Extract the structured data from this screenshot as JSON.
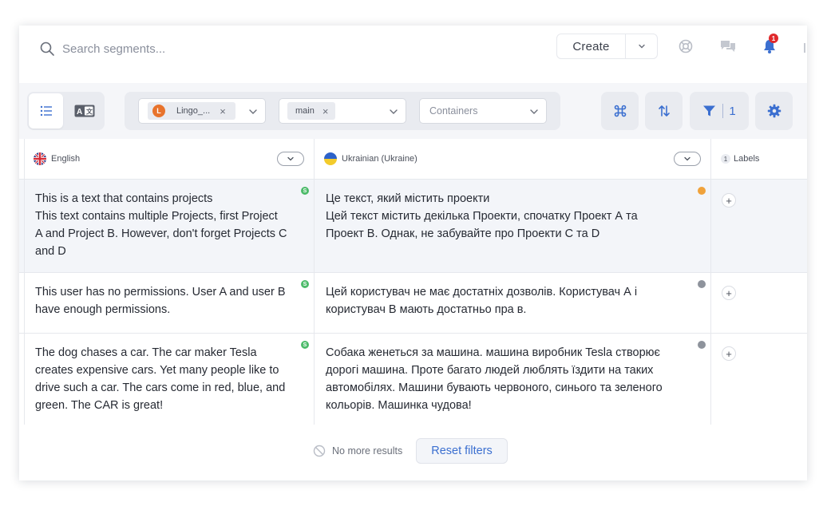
{
  "search": {
    "placeholder": "Search segments..."
  },
  "header": {
    "create_label": "Create",
    "notification_count": "1",
    "icons": [
      "search-icon",
      "chevron-down-icon",
      "help-lifebuoy-icon",
      "chat-bubbles-icon",
      "bell-icon"
    ]
  },
  "toolbar": {
    "view_modes": [
      "list-view-icon",
      "translate-view-icon"
    ],
    "filters": {
      "project": {
        "avatar": "L",
        "label": "Lingo_..."
      },
      "branch": {
        "label": "main"
      },
      "containers": {
        "placeholder": "Containers"
      }
    },
    "actions": {
      "command_icon": "command-icon",
      "sort_icon": "sort-arrows-icon",
      "filter_icon": "filter-funnel-icon",
      "filter_count": "1",
      "settings_icon": "gear-icon"
    }
  },
  "columns": {
    "source_lang": "English",
    "target_lang": "Ukrainian (Ukraine)",
    "labels_count": "1",
    "labels": "Labels"
  },
  "rows": [
    {
      "source_line1": "This is a text that contains projects",
      "source_line2": "This text contains multiple Projects, first Project",
      "source_line3": "A and Project B. However, don't forget Projects C",
      "source_line4": "and D",
      "target_line1": "Це текст, який містить проекти",
      "target_line2": "Цей текст містить декілька Проекти, спочатку Проект А та",
      "target_line3": "Проект В. Однак, не забувайте про Проекти С та D",
      "source_status": "S",
      "status_color": "#f0a23b"
    },
    {
      "source_line1": "This user has no permissions. User A and user B",
      "source_line2": "have enough permissions.",
      "target_line1": "Цей користувач не має достатніх дозволів. Користувач А і",
      "target_line2": "користувач В мають достатньо пра в.",
      "source_status": "S",
      "status_color": "#8e939c"
    },
    {
      "source_line1": "The dog chases a car. The car maker Tesla",
      "source_line2": "creates expensive cars. Yet many people like to",
      "source_line3": "drive such a car. The cars come in red, blue, and",
      "source_line4": "green. The CAR is great!",
      "target_line1": "Собака женеться за машина. машина виробник Tesla створює",
      "target_line2": "дорогі машина. Проте багато людей люблять їздити на таких",
      "target_line3": "автомобілях. Машини бувають червоного, синього та зеленого",
      "target_line4": "кольорів. Машинка чудова!",
      "source_status": "S",
      "status_color": "#8e939c"
    }
  ],
  "footer": {
    "no_more": "No more results",
    "reset_label": "Reset filters"
  },
  "colors": {
    "accent": "#3b6fd0",
    "term_highlight": "#e9eefb",
    "term_box": "#e05a1f"
  }
}
